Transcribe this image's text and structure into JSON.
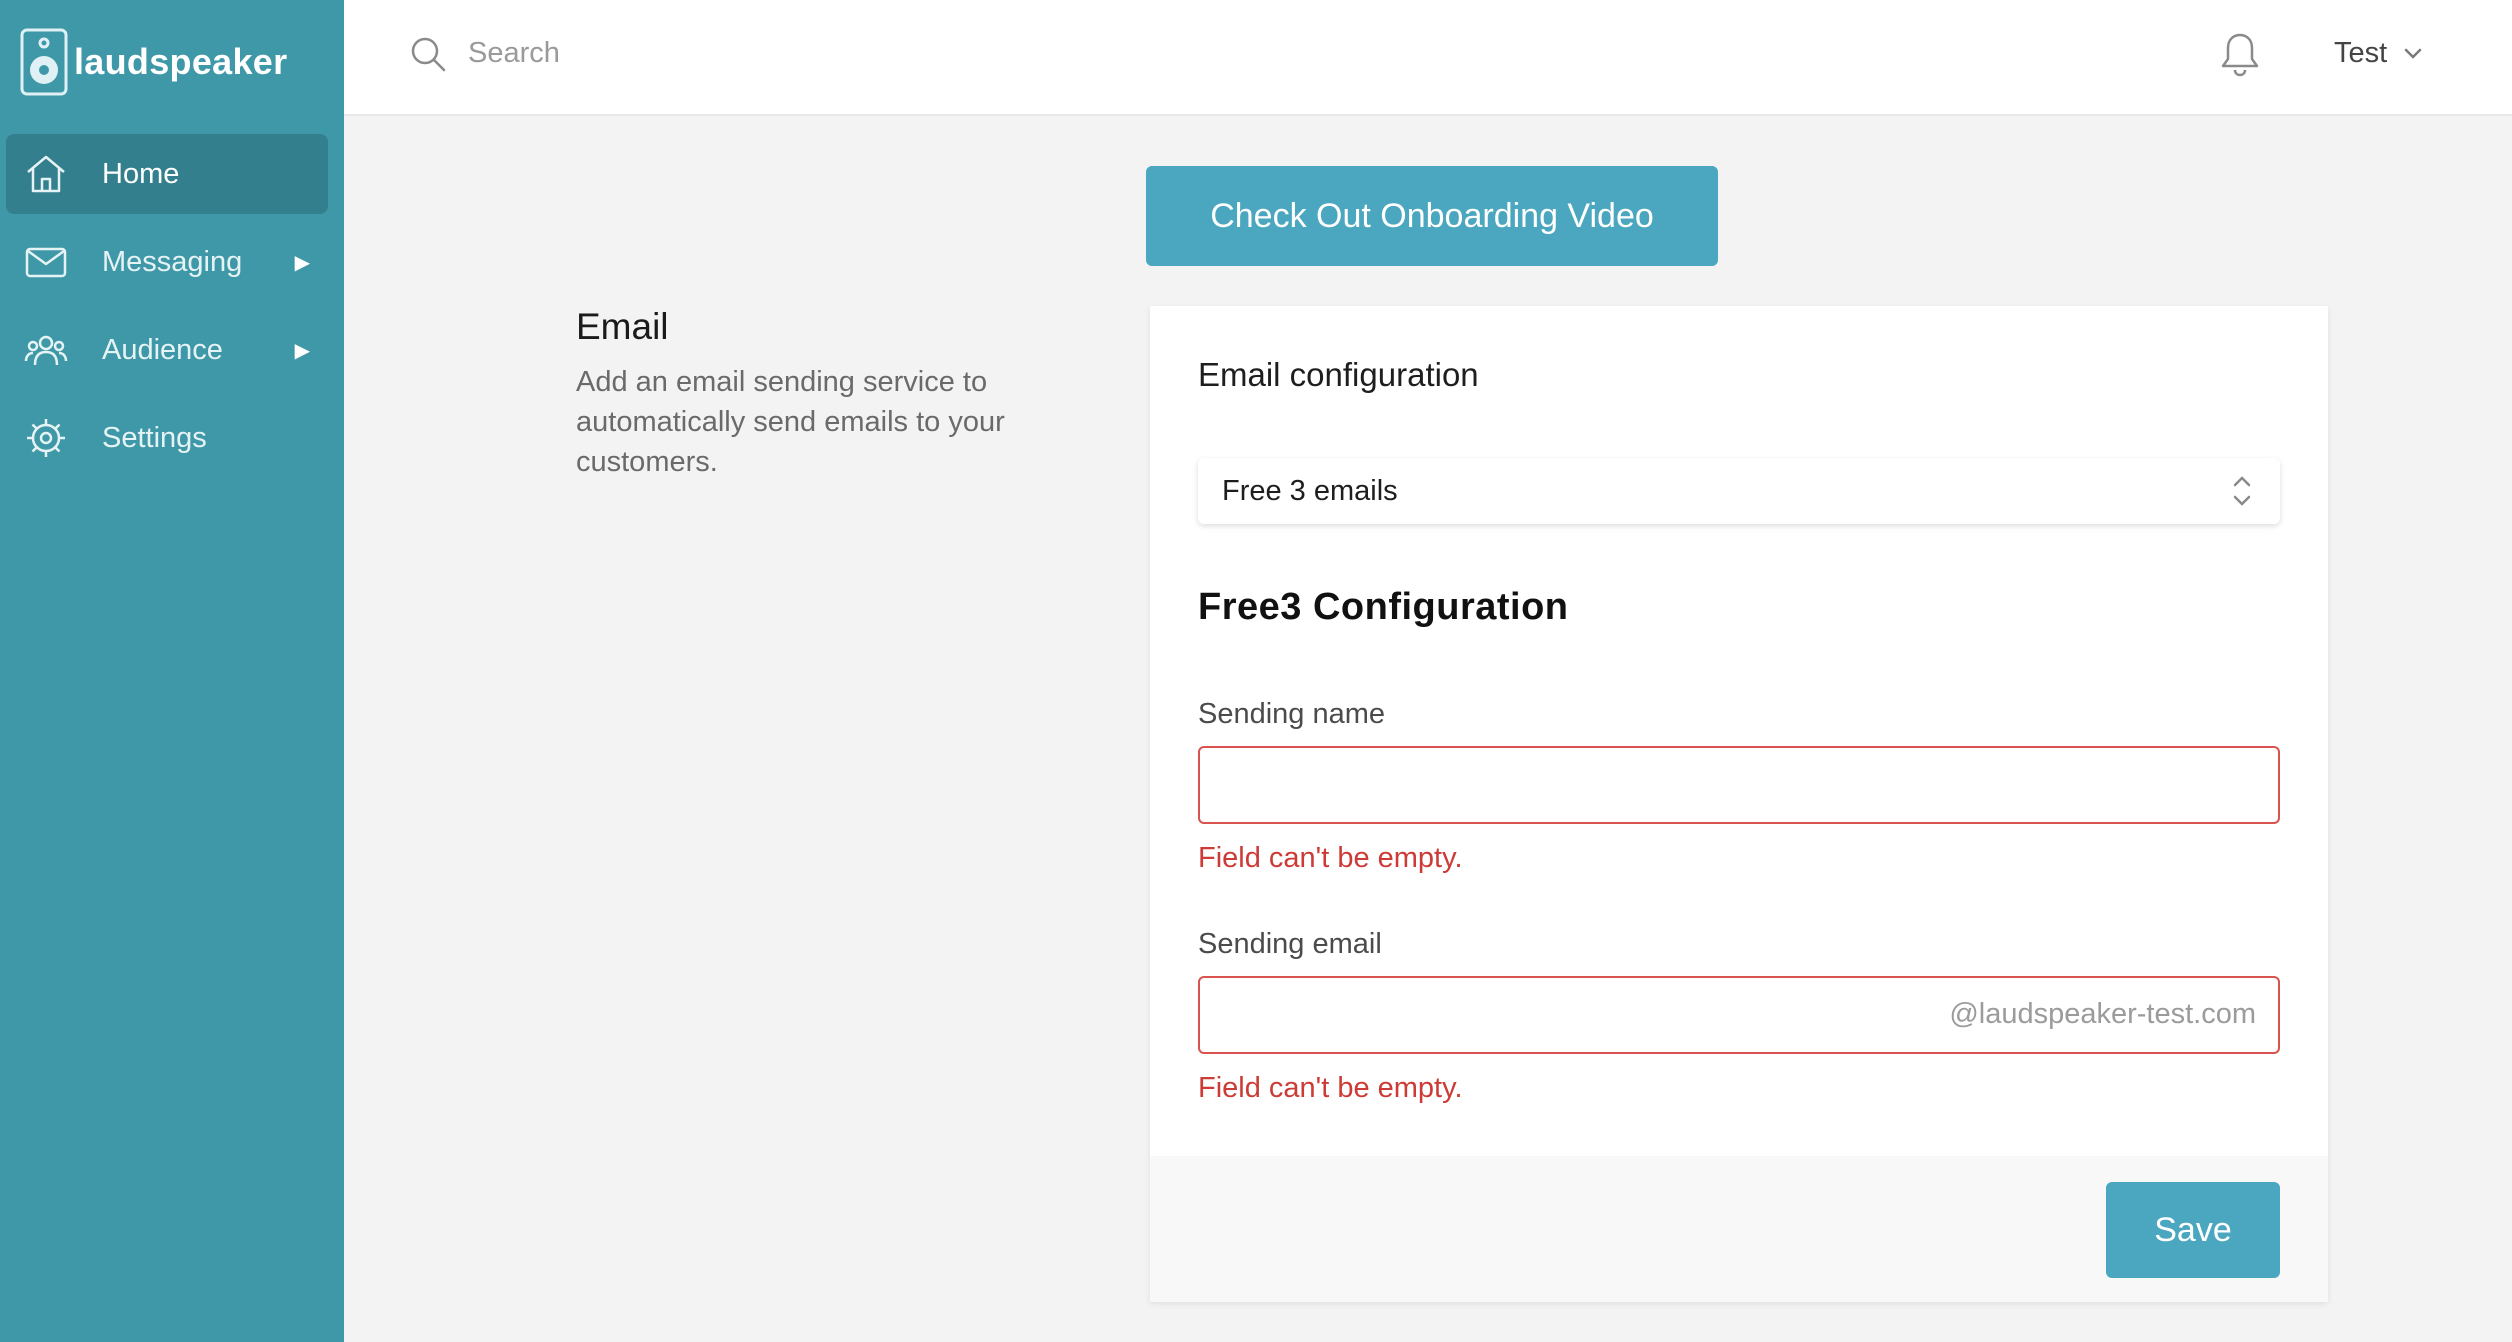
{
  "app": {
    "brand": "laudspeaker",
    "accent_color": "#3f98a8",
    "button_color": "#4ba7bf",
    "error_color": "#cc3b36"
  },
  "sidebar": {
    "items": [
      {
        "label": "Home",
        "icon": "home-icon",
        "active": true,
        "has_submenu": false
      },
      {
        "label": "Messaging",
        "icon": "mail-icon",
        "active": false,
        "has_submenu": true,
        "arrow": "▶"
      },
      {
        "label": "Audience",
        "icon": "people-icon",
        "active": false,
        "has_submenu": true,
        "arrow": "▶"
      },
      {
        "label": "Settings",
        "icon": "gear-icon",
        "active": false,
        "has_submenu": false
      }
    ]
  },
  "topbar": {
    "search_placeholder": "Search",
    "user_name": "Test"
  },
  "main": {
    "onboarding_button": "Check Out Onboarding Video",
    "section_title": "Email",
    "section_description": "Add an email sending service to automatically send emails to your customers."
  },
  "card": {
    "title": "Email configuration",
    "select_value": "Free 3 emails",
    "config_title": "Free3 Configuration",
    "fields": [
      {
        "label": "Sending name",
        "value": "",
        "suffix": "",
        "error": "Field can't be empty."
      },
      {
        "label": "Sending email",
        "value": "",
        "suffix": "@laudspeaker-test.com",
        "error": "Field can't be empty."
      }
    ],
    "save_label": "Save"
  }
}
